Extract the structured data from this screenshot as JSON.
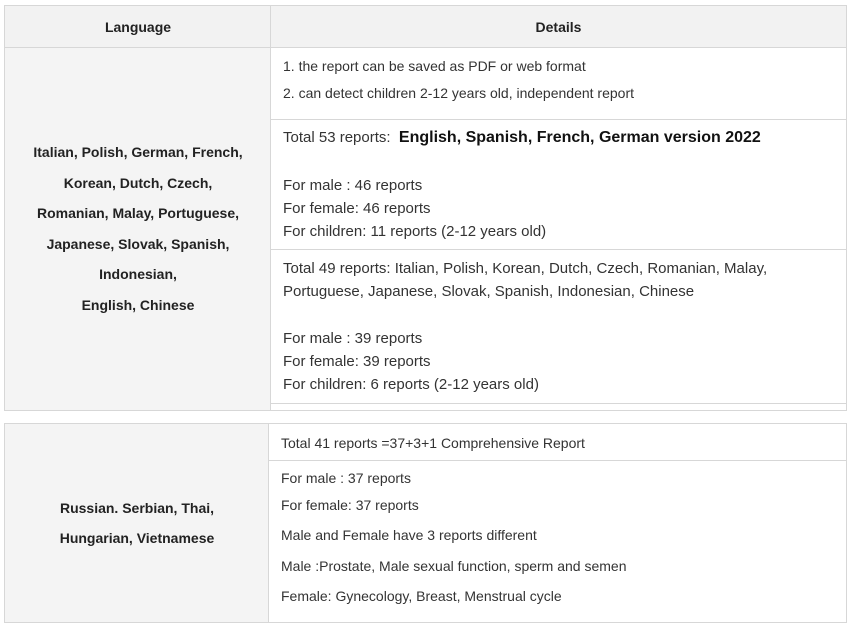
{
  "table1": {
    "header": {
      "language": "Language",
      "details": "Details"
    },
    "languages": [
      "Italian, Polish, German, French,",
      "Korean, Dutch, Czech,",
      "Romanian, Malay, Portuguese,",
      "Japanese, Slovak, Spanish,",
      "Indonesian,",
      "English, Chinese"
    ],
    "row1": {
      "line1": "1. the report can be saved as PDF or web format",
      "line2": "2. can detect children 2-12 years old, independent report"
    },
    "row2": {
      "total_prefix": "Total 53 reports:",
      "total_highlight": "English, Spanish, French, German version 2022",
      "male": "For male : 46 reports",
      "female": "For female: 46 reports",
      "children": "For children: 11 reports (2-12 years old)"
    },
    "row3": {
      "total_line1": "Total 49 reports: Italian, Polish, Korean, Dutch, Czech, Romanian, Malay,",
      "total_line2": "Portuguese, Japanese, Slovak, Spanish, Indonesian, Chinese",
      "male": "For male : 39 reports",
      "female": "For female: 39 reports",
      "children": "For children: 6 reports (2-12 years old)"
    }
  },
  "table2": {
    "languages": [
      "Russian. Serbian, Thai,",
      "Hungarian, Vietnamese"
    ],
    "row1": {
      "total": "Total 41 reports =37+3+1 Comprehensive Report"
    },
    "row2": {
      "male": "For male : 37 reports",
      "female": "For female: 37 reports",
      "diff": "Male and Female have 3 reports different",
      "male_reports": "Male :Prostate, Male sexual function, sperm and semen",
      "female_reports": "Female: Gynecology, Breast, Menstrual cycle"
    }
  }
}
